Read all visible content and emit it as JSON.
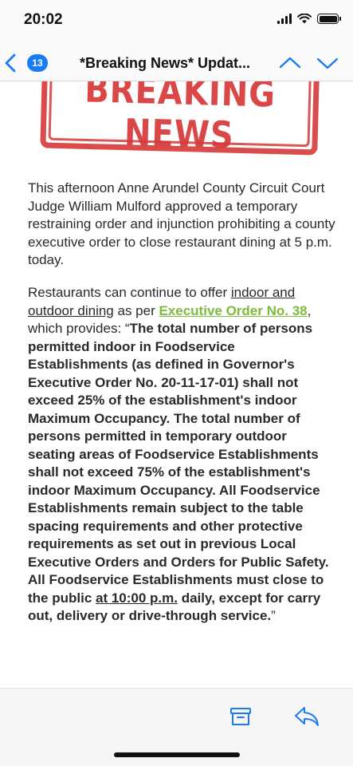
{
  "status_bar": {
    "time": "20:02"
  },
  "nav": {
    "unread_count": "13",
    "title": "*Breaking News* Updat..."
  },
  "email": {
    "stamp_text": "BREAKING NEWS",
    "paragraph1": "This afternoon Anne Arundel County Circuit Court Judge William Mulford approved a temporary restraining order and injunction prohibiting a county executive order to close restaurant dining at 5 p.m. today.",
    "p2_intro": "Restaurants can continue to offer ",
    "p2_underlined": "indoor and outdoor dining",
    "p2_as_per": " as per ",
    "p2_link": "Executive Order No. 38",
    "p2_provides": ", which provides: “",
    "p2_quote_part1": "The total number of persons permitted indoor in Foodservice Establishments (as defined in Governor's Executive Order No. 20-11-17-01) shall not exceed 25% of the establishment's indoor Maximum Occupancy. The total number of persons permitted in temporary outdoor seating areas of Foodservice Establishments shall not exceed 75% of the establishment's indoor Maximum Occupancy. All Foodservice Establishments remain subject to the table spacing requirements and other protective requirements as set out in previous Local Executive Orders and Orders for Public Safety. All Foodservice Establishments must close to the public ",
    "p2_quote_underlined": "at 10:00 p.m.",
    "p2_quote_part2": " daily, except for carry out, delivery or drive-through service.",
    "p2_closing": "”"
  },
  "colors": {
    "accent": "#1a7cf5",
    "link_green": "#7dbb3a",
    "stamp_red": "#d63838"
  },
  "icons": {
    "back": "chevron-left-icon",
    "up": "chevron-up-icon",
    "down": "chevron-down-icon",
    "archive": "archive-icon",
    "reply": "reply-icon"
  }
}
